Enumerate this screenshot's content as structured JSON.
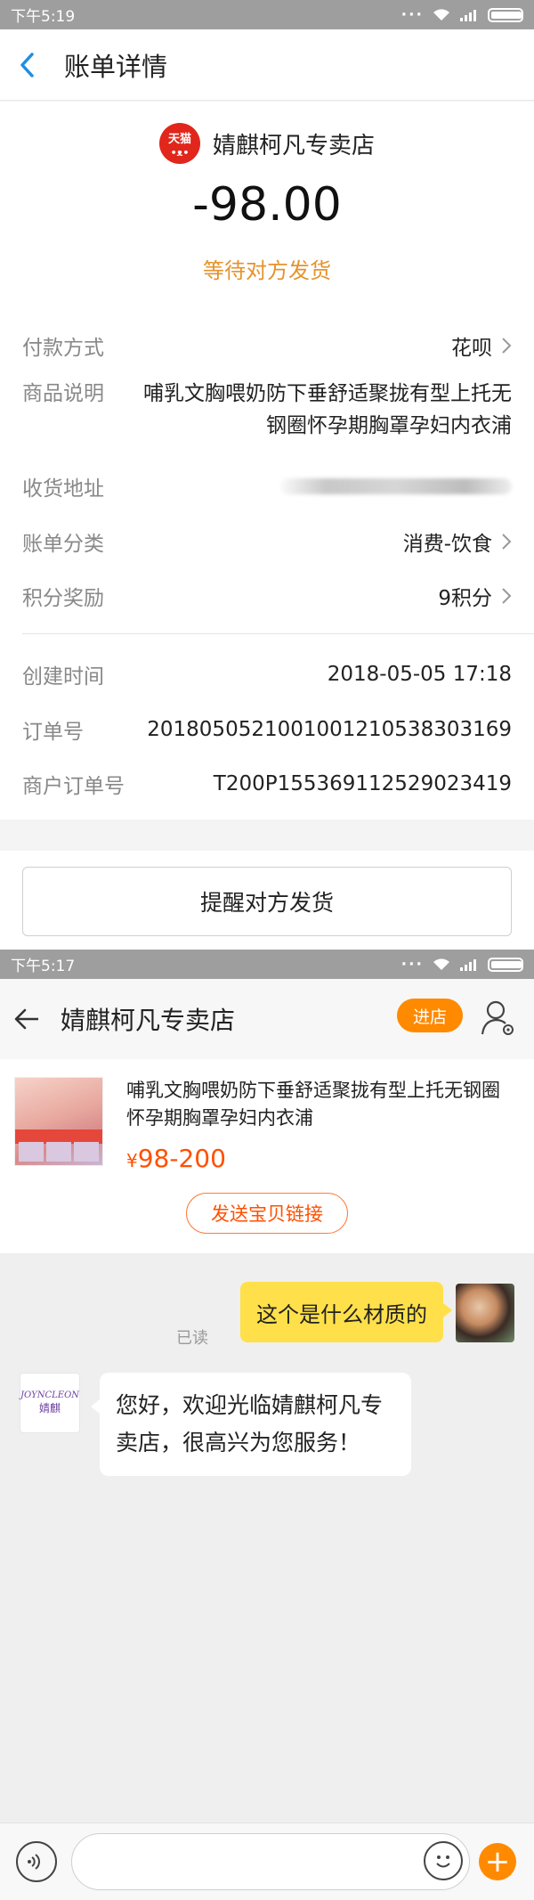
{
  "bill": {
    "status_bar": {
      "time": "下午5:19"
    },
    "nav": {
      "title": "账单详情"
    },
    "logo_text": "天猫",
    "shop_name": "婧麒柯凡专卖店",
    "amount": "-98.00",
    "status": "等待对方发货",
    "rows": [
      {
        "label": "付款方式",
        "value": "花呗"
      },
      {
        "label": "商品说明",
        "value": "哺乳文胸喂奶防下垂舒适聚拢有型上托无钢圈怀孕期胸罩孕妇内衣浦"
      },
      {
        "label": "收货地址",
        "value": ""
      },
      {
        "label": "账单分类",
        "value": "消费-饮食"
      },
      {
        "label": "积分奖励",
        "value": "9积分"
      },
      {
        "label": "创建时间",
        "value": "2018-05-05 17:18"
      },
      {
        "label": "订单号",
        "value": "2018050521001001210538303169"
      },
      {
        "label": "商户订单号",
        "value": "T200P155369112529023419"
      }
    ],
    "remind_button": "提醒对方发货"
  },
  "chat": {
    "status_bar": {
      "time": "下午5:17"
    },
    "nav": {
      "title": "婧麒柯凡专卖店",
      "enter_store": "进店"
    },
    "product": {
      "title": "哺乳文胸喂奶防下垂舒适聚拢有型上托无钢圈怀孕期胸罩孕妇内衣浦",
      "price_symbol": "¥",
      "price": "98-200",
      "send_link": "发送宝贝链接"
    },
    "messages": [
      {
        "side": "right",
        "text": "这个是什么材质的",
        "read": "已读"
      },
      {
        "side": "left",
        "text": "您好，欢迎光临婧麒柯凡专卖店，很高兴为您服务！"
      }
    ],
    "shop_avatar": {
      "en": "JOYNCLEON",
      "cn": "婧麒"
    },
    "input": {
      "placeholder": "",
      "value": ""
    }
  },
  "colors": {
    "accent_orange": "#ff8a00",
    "status_orange": "#e5932d",
    "price_orange": "#ff5000",
    "bubble_yellow": "#ffe04a",
    "back_blue": "#1e8fe1"
  }
}
